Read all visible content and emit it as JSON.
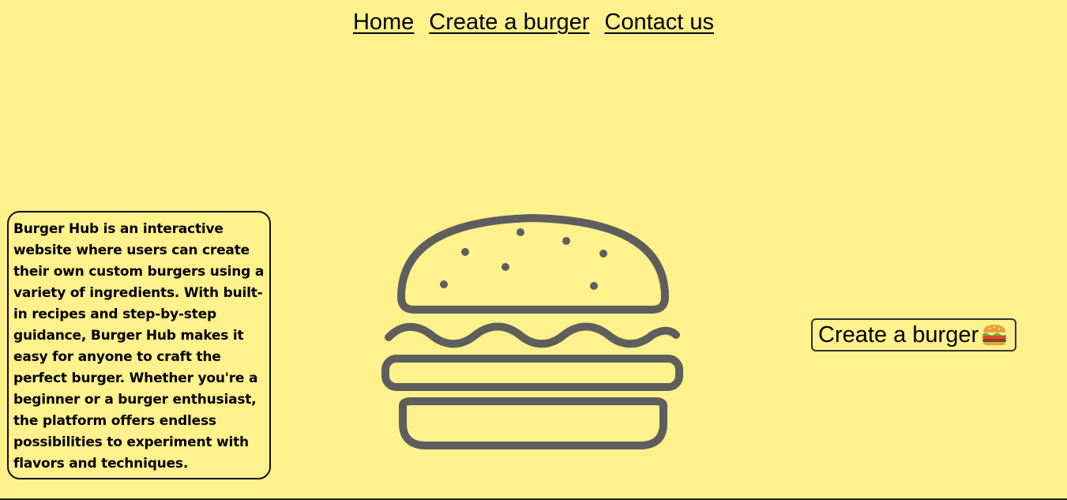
{
  "colors": {
    "background": "#FFF18C",
    "burger_stroke": "#5E5E5E"
  },
  "nav": {
    "items": [
      {
        "label": "Home"
      },
      {
        "label": "Create a burger"
      },
      {
        "label": "Contact us"
      }
    ]
  },
  "about": {
    "text": "Burger Hub is an interactive website where users can create their own custom burgers using a variety of ingredients. With built-in recipes and step-by-step guidance, Burger Hub makes it easy for anyone to craft the perfect burger. Whether you're a beginner or a burger enthusiast, the platform offers endless possibilities to experiment with flavors and techniques."
  },
  "hero": {
    "illustration": "burger-icon"
  },
  "cta": {
    "label": "Create a burger",
    "icon": "burger-emoji-icon"
  }
}
